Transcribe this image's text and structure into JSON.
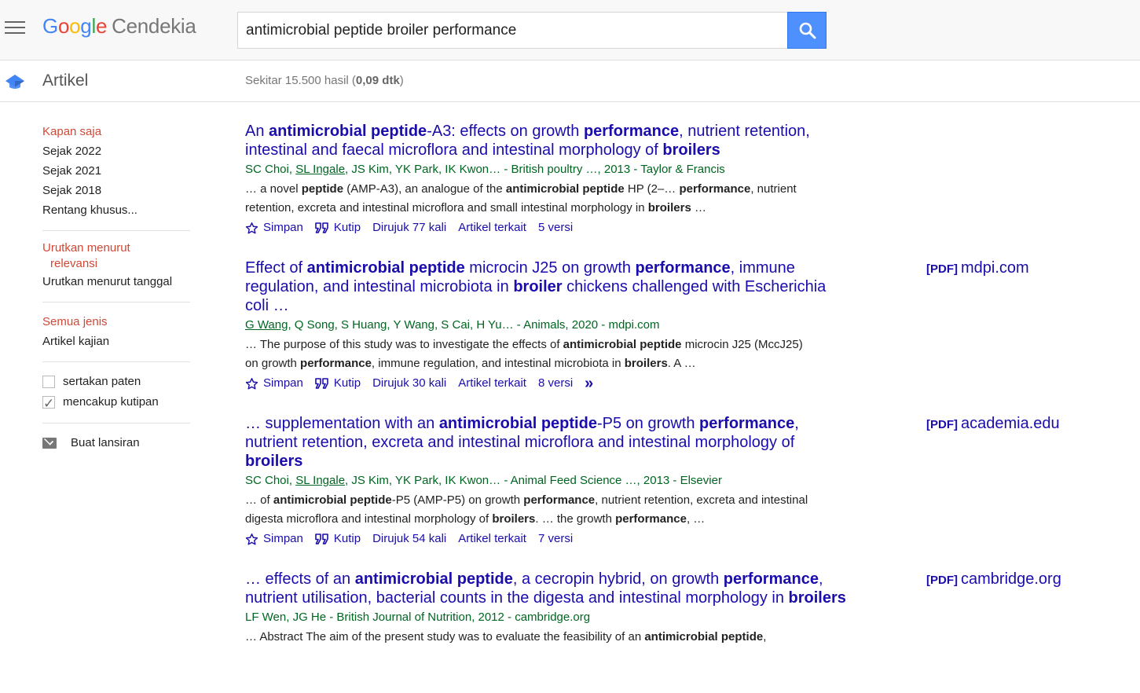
{
  "header": {
    "logo_letters": [
      "G",
      "o",
      "o",
      "g",
      "l",
      "e"
    ],
    "logo_suffix": "Cendekia",
    "search_value": "antimicrobial peptide broiler performance"
  },
  "subheader": {
    "section_title": "Artikel",
    "stats_prefix": "Sekitar 15.500 hasil (",
    "stats_time": "0,09 dtk",
    "stats_suffix": ")"
  },
  "sidebar": {
    "time_filters": [
      "Kapan saja",
      "Sejak 2022",
      "Sejak 2021",
      "Sejak 2018",
      "Rentang khusus..."
    ],
    "sort_options": [
      "Urutkan menurut",
      "relevansi",
      "Urutkan menurut tanggal"
    ],
    "type_filters": [
      "Semua jenis",
      "Artikel kajian"
    ],
    "checkboxes": [
      {
        "label": "sertakan paten",
        "checked": false
      },
      {
        "label": "mencakup kutipan",
        "checked": true
      }
    ],
    "alert_label": "Buat lansiran"
  },
  "actions": {
    "save": "Simpan",
    "cite": "Kutip",
    "related": "Artikel terkait"
  },
  "results": [
    {
      "title": [
        [
          "An ",
          false
        ],
        [
          "antimicrobial peptide",
          true
        ],
        [
          "-A3: effects on growth ",
          false
        ],
        [
          "performance",
          true
        ],
        [
          ", nutrient retention, intestinal and faecal microflora and intestinal morphology of ",
          false
        ],
        [
          "broilers",
          true
        ]
      ],
      "side_pdf": "",
      "side_domain": "",
      "meta": [
        [
          "SC Choi, ",
          false
        ],
        [
          "SL Ingale",
          true
        ],
        [
          ", JS Kim, YK Park, IK Kwon… - British poultry …, 2013 - Taylor & Francis",
          false
        ]
      ],
      "snippet": [
        [
          "… a novel ",
          false
        ],
        [
          "peptide",
          true
        ],
        [
          " (AMP-A3), an analogue of the ",
          false
        ],
        [
          "antimicrobial peptide",
          true
        ],
        [
          " HP (2–… ",
          false
        ],
        [
          "performance",
          true
        ],
        [
          ", nutrient retention, excreta and intestinal microflora and small intestinal morphology in ",
          false
        ],
        [
          "broilers",
          true
        ],
        [
          " …",
          false
        ]
      ],
      "cited_by": "Dirujuk 77 kali",
      "versions": "5 versi",
      "more_icon": false
    },
    {
      "title": [
        [
          "Effect of ",
          false
        ],
        [
          "antimicrobial peptide",
          true
        ],
        [
          " microcin J25 on growth ",
          false
        ],
        [
          "performance",
          true
        ],
        [
          ", immune regulation, and intestinal microbiota in ",
          false
        ],
        [
          "broiler",
          true
        ],
        [
          " chickens challenged with Escherichia coli …",
          false
        ]
      ],
      "side_pdf": "[PDF]",
      "side_domain": "mdpi.com",
      "meta": [
        [
          "G Wang",
          true
        ],
        [
          ", Q Song, S Huang, Y Wang, S Cai, H Yu… - Animals, 2020 - mdpi.com",
          false
        ]
      ],
      "snippet": [
        [
          "… The purpose of this study was to investigate the effects of ",
          false
        ],
        [
          "antimicrobial peptide",
          true
        ],
        [
          " microcin J25 (MccJ25) on growth ",
          false
        ],
        [
          "performance",
          true
        ],
        [
          ", immune regulation, and intestinal microbiota in ",
          false
        ],
        [
          "broilers",
          true
        ],
        [
          ". A …",
          false
        ]
      ],
      "cited_by": "Dirujuk 30 kali",
      "versions": "8 versi",
      "more_icon": true
    },
    {
      "title": [
        [
          "… supplementation with an ",
          false
        ],
        [
          "antimicrobial peptide",
          true
        ],
        [
          "-P5 on growth ",
          false
        ],
        [
          "performance",
          true
        ],
        [
          ", nutrient retention, excreta and intestinal microflora and intestinal morphology of ",
          false
        ],
        [
          "broilers",
          true
        ]
      ],
      "side_pdf": "[PDF]",
      "side_domain": "academia.edu",
      "meta": [
        [
          "SC Choi, ",
          false
        ],
        [
          "SL Ingale",
          true
        ],
        [
          ", JS Kim, YK Park, IK Kwon… - Animal Feed Science …, 2013 - Elsevier",
          false
        ]
      ],
      "snippet": [
        [
          "… of ",
          false
        ],
        [
          "antimicrobial peptide",
          true
        ],
        [
          "-P5 (AMP-P5) on growth ",
          false
        ],
        [
          "performance",
          true
        ],
        [
          ", nutrient retention, excreta and intestinal digesta microflora and intestinal morphology of ",
          false
        ],
        [
          "broilers",
          true
        ],
        [
          ". … the growth ",
          false
        ],
        [
          "performance",
          true
        ],
        [
          ", …",
          false
        ]
      ],
      "cited_by": "Dirujuk 54 kali",
      "versions": "7 versi",
      "more_icon": false
    },
    {
      "title": [
        [
          "… effects of an ",
          false
        ],
        [
          "antimicrobial peptide",
          true
        ],
        [
          ", a cecropin hybrid, on growth ",
          false
        ],
        [
          "performance",
          true
        ],
        [
          ", nutrient utilisation, bacterial counts in the digesta and intestinal morphology in ",
          false
        ],
        [
          "broilers",
          true
        ]
      ],
      "side_pdf": "[PDF]",
      "side_domain": "cambridge.org",
      "meta": [
        [
          "LF Wen, JG He - British Journal of Nutrition, 2012 - cambridge.org",
          false
        ]
      ],
      "snippet": [
        [
          "… Abstract The aim of the present study was to evaluate the feasibility of an ",
          false
        ],
        [
          "antimicrobial peptide",
          true
        ],
        [
          ",",
          false
        ]
      ],
      "cited_by": "",
      "versions": "",
      "more_icon": false
    }
  ],
  "colors": {
    "link": "#1a0dab",
    "meta_green": "#006621",
    "selected_red": "#d14836",
    "search_blue": "#4d90fe"
  }
}
